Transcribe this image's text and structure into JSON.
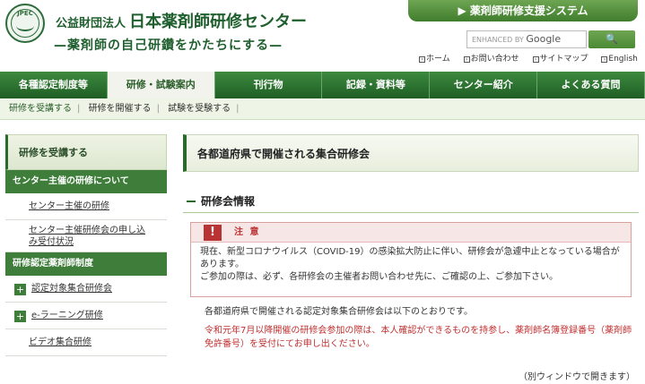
{
  "header": {
    "logo_text": "JPEC",
    "org_prefix": "公益財団法人",
    "org_name": "日本薬剤師研修センター",
    "slogan": "—薬剤師の自己研鑽をかたちにする—",
    "system_button": "▶ 薬剤師研修支援システム",
    "search_placeholder": "ENHANCED BY",
    "search_brand": "Google",
    "search_button": "🔍",
    "util_links": [
      "ホーム",
      "お問い合わせ",
      "サイトマップ",
      "English"
    ]
  },
  "nav": {
    "items": [
      "各種認定制度等",
      "研修・試験案内",
      "刊行物",
      "記録・資料等",
      "センター紹介",
      "よくある質問"
    ],
    "active_index": 1
  },
  "subnav": {
    "items": [
      "研修を受講する",
      "研修を開催する",
      "試験を受験する"
    ]
  },
  "sidebar": {
    "heading": "研修を受講する",
    "cat1": "センター主催の研修について",
    "link1": "センター主催の研修",
    "link2a": "センター主催研修会の申し込",
    "link2b": "み受付状況",
    "cat2": "研修認定薬剤師制度",
    "link3": "認定対象集合研修会",
    "link4": "e-ラーニング研修",
    "link5": "ビデオ集合研修"
  },
  "main": {
    "page_title": "各都道府県で開催される集合研修会",
    "section_title": "研修会情報",
    "notice_mark": "!",
    "notice_title": "注 意",
    "notice_line1": "現在、新型コロナウイルス（COVID-19）の感染拡大防止に伴い、研修会が急遽中止となっている場合が",
    "notice_line2": "あります。",
    "notice_line3": "ご参加の際は、必ず、各研修会の主催者お問い合わせ先に、ご確認の上、ご参加下さい。",
    "intro": "各都道府県で開催される認定対象集合研修会は以下のとおりです。",
    "red_note": "令和元年7月以降開催の研修会参加の際は、本人確認ができるものを持参し、薬剤師名簿登録番号（薬剤師免許番号）を受付にてお申し出ください。",
    "window_note": "（別ウィンドウで開きます）"
  },
  "colors": {
    "brand_green": "#1f5e24",
    "warning_red": "#c03030"
  }
}
